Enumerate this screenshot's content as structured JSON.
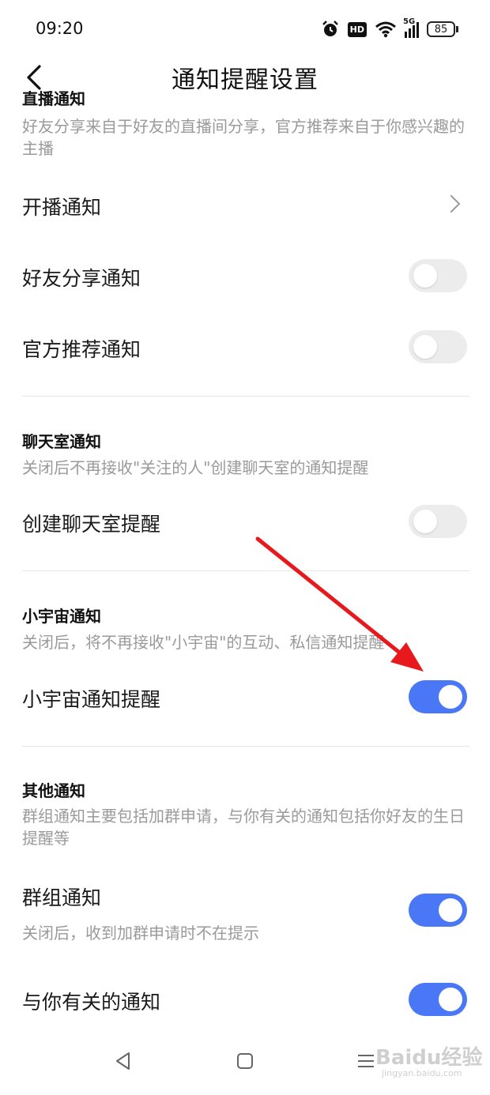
{
  "status": {
    "time": "09:20",
    "hd_badge": "HD",
    "network": "5G",
    "battery": "85"
  },
  "header": {
    "title": "通知提醒设置"
  },
  "live_section": {
    "title": "直播通知",
    "desc": "好友分享来自于好友的直播间分享，官方推荐来自于你感兴趣的主播",
    "rows": [
      {
        "label": "开播通知",
        "control": "chevron"
      },
      {
        "label": "好友分享通知",
        "control": "toggle",
        "on": false
      },
      {
        "label": "官方推荐通知",
        "control": "toggle",
        "on": false
      }
    ]
  },
  "chatroom_section": {
    "title": "聊天室通知",
    "desc": "关闭后不再接收\"关注的人\"创建聊天室的通知提醒",
    "rows": [
      {
        "label": "创建聊天室提醒",
        "control": "toggle",
        "on": false
      }
    ]
  },
  "universe_section": {
    "title": "小宇宙通知",
    "desc": "关闭后，将不再接收\"小宇宙\"的互动、私信通知提醒",
    "rows": [
      {
        "label": "小宇宙通知提醒",
        "control": "toggle",
        "on": true
      }
    ]
  },
  "other_section": {
    "title": "其他通知",
    "desc": "群组通知主要包括加群申请，与你有关的通知包括你好友的生日提醒等",
    "rows": [
      {
        "label": "群组通知",
        "sub": "关闭后，收到加群申请时不在提示",
        "control": "toggle",
        "on": true
      },
      {
        "label": "与你有关的通知",
        "control": "toggle",
        "on": true
      }
    ]
  },
  "watermark": {
    "text": "Baidu经验",
    "sub": "jingyan.baidu.com"
  },
  "colors": {
    "toggle_on": "#4a77f5",
    "toggle_off": "#ececec",
    "annotation_arrow": "#e8191c"
  }
}
